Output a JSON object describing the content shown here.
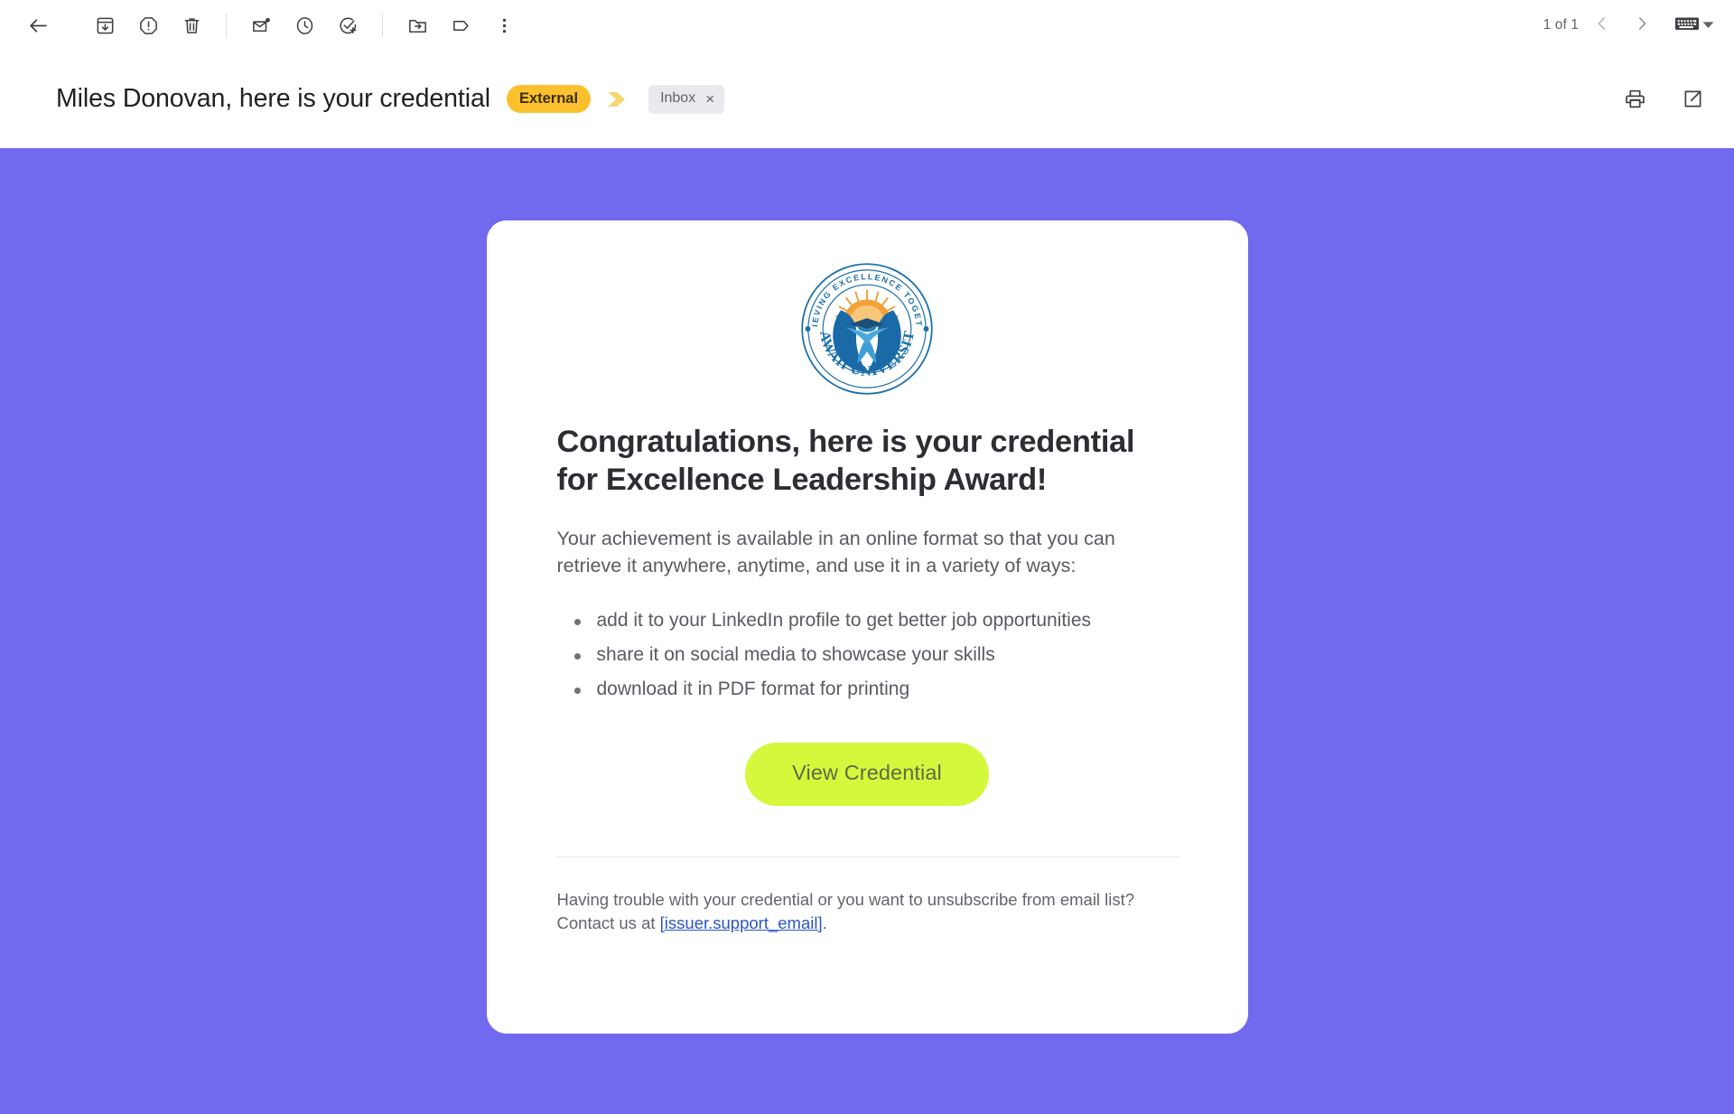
{
  "toolbar": {
    "back_label": "Back to Inbox",
    "actions": [
      {
        "name": "archive",
        "label": "Archive"
      },
      {
        "name": "report-spam",
        "label": "Report spam"
      },
      {
        "name": "delete",
        "label": "Delete"
      },
      {
        "name": "mark-unread",
        "label": "Mark as unread"
      },
      {
        "name": "snooze",
        "label": "Snooze"
      },
      {
        "name": "add-to-tasks",
        "label": "Add to tasks"
      },
      {
        "name": "move-to",
        "label": "Move to"
      },
      {
        "name": "labels",
        "label": "Labels"
      },
      {
        "name": "more",
        "label": "More"
      }
    ],
    "counter": "1 of 1",
    "older_label": "Older",
    "newer_label": "Newer",
    "keyboard_label": "Keyboard shortcuts"
  },
  "header": {
    "subject": "Miles Donovan, here is your credential",
    "external_badge": "External",
    "important_marker_label": "Important",
    "label_chip": "Inbox",
    "label_chip_close": "×",
    "print_label": "Print all",
    "popout_label": "Open in new window"
  },
  "email": {
    "background_color": "#7169ee",
    "card_background": "#ffffff",
    "logo": {
      "name": "hawaii-university-seal",
      "top_arc_text": "ACHIEVING EXCELLENCE TOGETHER",
      "bottom_arc_text": "HAWAII UNIVERSITY",
      "ring_color": "#1b6fa8",
      "sun_color": "#f0941f",
      "hands_color": "#1a6aa8",
      "inner_accent": "#4aa8dd"
    },
    "headline": "Congratulations, here is your credential for Excellence Leadership Award!",
    "lede": "Your achievement is available in an online format so that you can retrieve it anywhere, anytime, and use it in a variety of ways:",
    "benefits": [
      "add it to your LinkedIn profile to get better job opportunities",
      "share it on social media to showcase your skills",
      "download it in PDF format for printing"
    ],
    "cta": {
      "label": "View Credential",
      "background_color": "#d4f93c",
      "text_color": "#5e6b48"
    },
    "footnote_prefix": "Having trouble with your credential or you want to unsubscribe from email list? Contact us at ",
    "footnote_link": "[issuer.support_email]",
    "footnote_suffix": "."
  }
}
